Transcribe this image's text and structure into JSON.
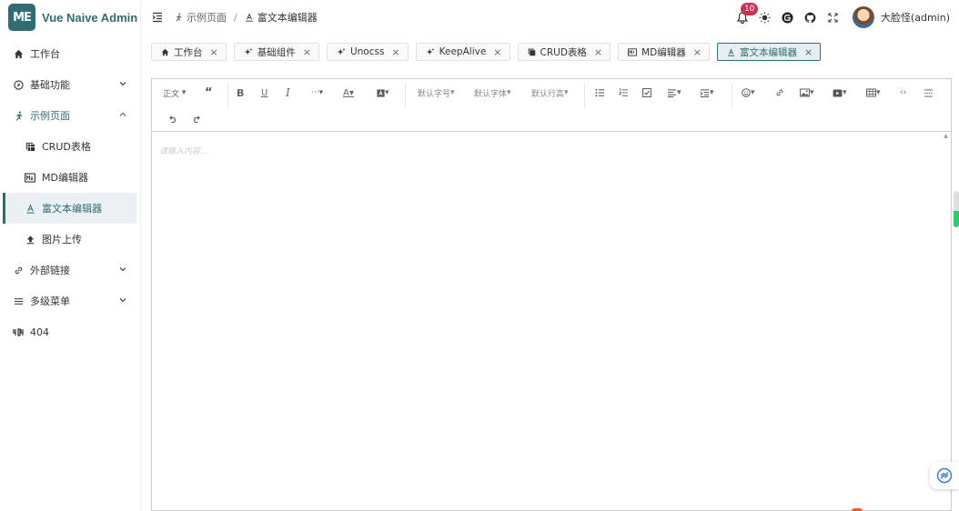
{
  "brand": {
    "logo_text": "ME",
    "title": "Vue Naive Admin",
    "accent": "#316c72"
  },
  "sidebar": {
    "items": [
      {
        "label": "工作台",
        "icon": "home-icon"
      },
      {
        "label": "基础功能",
        "icon": "compass-icon",
        "expandable": true,
        "expanded": false
      },
      {
        "label": "示例页面",
        "icon": "run-icon",
        "expandable": true,
        "expanded": true
      },
      {
        "label": "CRUD表格",
        "icon": "table-copy-icon",
        "sub": true
      },
      {
        "label": "MD编辑器",
        "icon": "markdown-icon",
        "sub": true
      },
      {
        "label": "富文本编辑器",
        "icon": "text-format-icon",
        "sub": true,
        "active": true
      },
      {
        "label": "图片上传",
        "icon": "upload-icon",
        "sub": true
      },
      {
        "label": "外部链接",
        "icon": "link-icon",
        "expandable": true,
        "expanded": false
      },
      {
        "label": "多级菜单",
        "icon": "menu-lines-icon",
        "expandable": true,
        "expanded": false
      },
      {
        "label": "404",
        "icon": "error-404-icon"
      }
    ]
  },
  "header": {
    "breadcrumb": [
      {
        "label": "示例页面",
        "icon": "run-icon"
      },
      {
        "label": "富文本编辑器",
        "icon": "text-format-icon"
      }
    ],
    "breadcrumb_sep": "/",
    "notification_count": "10",
    "username": "大脸怪(admin)"
  },
  "tabs": [
    {
      "label": "工作台",
      "icon": "home-icon"
    },
    {
      "label": "基础组件",
      "icon": "sparkle-icon"
    },
    {
      "label": "Unocss",
      "icon": "sparkle-icon"
    },
    {
      "label": "KeepAlive",
      "icon": "sparkle-icon"
    },
    {
      "label": "CRUD表格",
      "icon": "table-copy-icon"
    },
    {
      "label": "MD编辑器",
      "icon": "markdown-icon"
    },
    {
      "label": "富文本编辑器",
      "icon": "text-format-icon",
      "active": true
    }
  ],
  "tab_close": "×",
  "editor": {
    "toolbar": {
      "paragraph": "正文",
      "font_size": "默认字号",
      "font_family": "默认字体",
      "line_height": "默认行高"
    },
    "placeholder": "请输入内容..."
  }
}
